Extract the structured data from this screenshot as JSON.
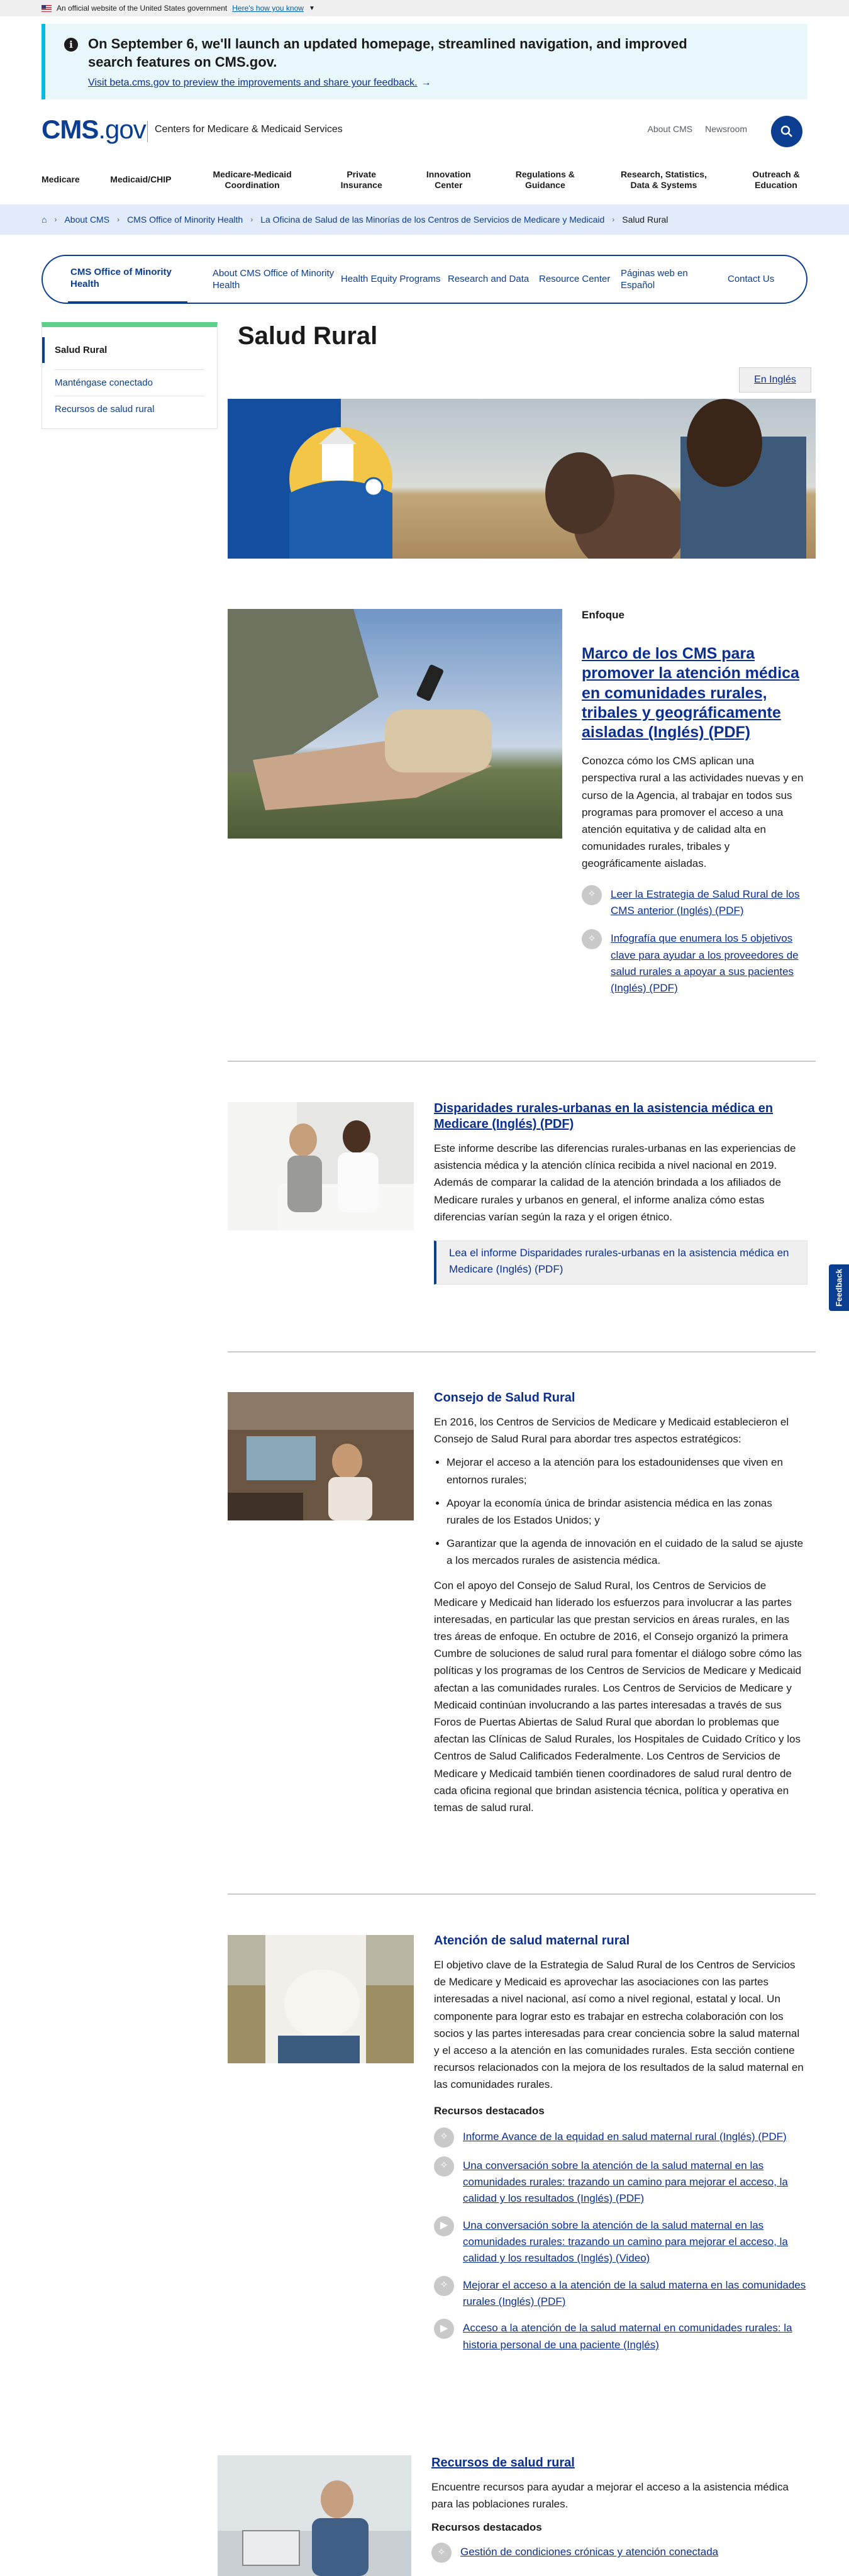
{
  "gov_banner": {
    "text": "An official website of the United States government",
    "link": "Here's how you know"
  },
  "alert": {
    "message": "On September 6, we'll launch an updated homepage, streamlined navigation, and improved search features on CMS.gov.",
    "link": "Visit beta.cms.gov to preview the improvements and share your feedback."
  },
  "header": {
    "logo_main": "CMS",
    "logo_suffix": ".gov",
    "tagline": "Centers for Medicare & Medicaid Services",
    "about": "About CMS",
    "newsroom": "Newsroom"
  },
  "main_nav": [
    "Medicare",
    "Medicaid/CHIP",
    "Medicare-Medicaid Coordination",
    "Private Insurance",
    "Innovation Center",
    "Regulations & Guidance",
    "Research, Statistics, Data & Systems",
    "Outreach & Education"
  ],
  "breadcrumb": [
    "About CMS",
    "CMS Office of Minority Health",
    "La Oficina de Salud de las Minorías de los Centros de Servicios de Medicare y Medicaid",
    "Salud Rural"
  ],
  "sec_nav": [
    "CMS Office of Minority Health",
    "About CMS Office of Minority Health",
    "Health Equity Programs",
    "Research and Data",
    "Resource Center",
    "Páginas web en Español",
    "Contact Us"
  ],
  "side_nav": [
    "Salud Rural",
    "Manténgase conectado",
    "Recursos de salud rural"
  ],
  "page_title": "Salud Rural",
  "lang_button": "En Inglés",
  "enfoque": {
    "label": "Enfoque",
    "title": "Marco de los CMS para promover la atención médica en comunidades rurales, tribales y geográficamente aisladas (Inglés) (PDF)",
    "body": "Conozca cómo los CMS aplican una perspectiva rural a las actividades nuevas y en curso de la Agencia, al trabajar en todos sus programas para promover el acceso a una atención equitativa y de calidad alta en comunidades rurales, tribales y geográficamente aisladas.",
    "links": [
      "Leer la Estrategia de Salud Rural de los CMS anterior (Inglés) (PDF)",
      "Infografía que enumera los 5 objetivos clave para ayudar a los proveedores de salud rurales a apoyar a sus pacientes (Inglés) (PDF)"
    ]
  },
  "disparidades": {
    "title": "Disparidades rurales-urbanas en la asistencia médica en Medicare (Inglés) (PDF)",
    "body": "Este informe describe las diferencias rurales-urbanas en las experiencias de asistencia médica y la atención clínica recibida a nivel nacional en 2019. Además de comparar la calidad de la atención brindada a los afiliados de Medicare rurales y urbanos en general, el informe analiza cómo estas diferencias varían según la raza y el origen étnico.",
    "box_link": "Lea el informe Disparidades rurales-urbanas en la asistencia médica en Medicare (Inglés) (PDF)"
  },
  "consejo": {
    "title": "Consejo de Salud Rural",
    "intro": "En 2016, los Centros de Servicios de Medicare y Medicaid establecieron el Consejo de Salud Rural para abordar tres aspectos estratégicos:",
    "bullets": [
      "Mejorar el acceso a la atención para los estadounidenses que viven en entornos rurales;",
      "Apoyar la economía única de brindar asistencia médica en las zonas rurales de los Estados Unidos; y",
      "Garantizar que la agenda de innovación en el cuidado de la salud se ajuste a los mercados rurales de asistencia médica."
    ],
    "body": "Con el apoyo del Consejo de Salud Rural, los Centros de Servicios de Medicare y Medicaid han liderado los esfuerzos para involucrar a las partes interesadas, en particular las que prestan servicios en áreas rurales, en las tres áreas de enfoque. En octubre de 2016, el Consejo organizó la primera Cumbre de soluciones de salud rural para fomentar el diálogo sobre cómo las políticas y los programas de los Centros de Servicios de Medicare y Medicaid afectan a las comunidades rurales. Los Centros de Servicios de Medicare y Medicaid continúan involucrando a las partes interesadas a través de sus Foros de Puertas Abiertas de Salud Rural que abordan lo problemas que afectan las Clínicas de Salud Rurales, los Hospitales de Cuidado Crítico y los Centros de Salud Calificados Federalmente. Los Centros de Servicios de Medicare y Medicaid también tienen coordinadores de salud rural dentro de cada oficina regional que brindan asistencia técnica, política y operativa en temas de salud rural."
  },
  "maternal": {
    "title": "Atención de salud maternal rural",
    "body": "El objetivo clave de la Estrategia de Salud Rural de los Centros de Servicios de Medicare y Medicaid es aprovechar las asociaciones con las partes interesadas a nivel nacional, así como a nivel regional, estatal y local. Un componente para lograr esto es trabajar en estrecha colaboración con los socios y las partes interesadas para crear conciencia sobre la salud maternal y el acceso a la atención en las comunidades rurales. Esta sección contiene recursos relacionados con la mejora de los resultados de la salud maternal en las comunidades rurales.",
    "resources_label": "Recursos destacados",
    "links": [
      "Informe Avance de la equidad en salud maternal rural (Inglés) (PDF)",
      "Una conversación sobre la atención de la salud maternal en las comunidades rurales: trazando un camino para mejorar el acceso, la calidad y los resultados (Inglés) (PDF)",
      "Una conversación sobre la atención de la salud maternal en las comunidades rurales: trazando un camino para mejorar el acceso, la calidad y los resultados (Inglés) (Video)",
      "Mejorar el acceso a la atención de la salud materna en las comunidades rurales (Inglés) (PDF)",
      "Acceso a la atención de la salud maternal en comunidades rurales: la historia personal de una paciente (Inglés)"
    ]
  },
  "recursos": {
    "title": "Recursos de salud rural",
    "body": "Encuentre recursos para ayudar a mejorar el acceso a la asistencia médica para las poblaciones rurales.",
    "resources_label": "Recursos destacados",
    "links": [
      "Gestión de condiciones crónicas y atención conectada"
    ]
  },
  "feedback": "Feedback"
}
